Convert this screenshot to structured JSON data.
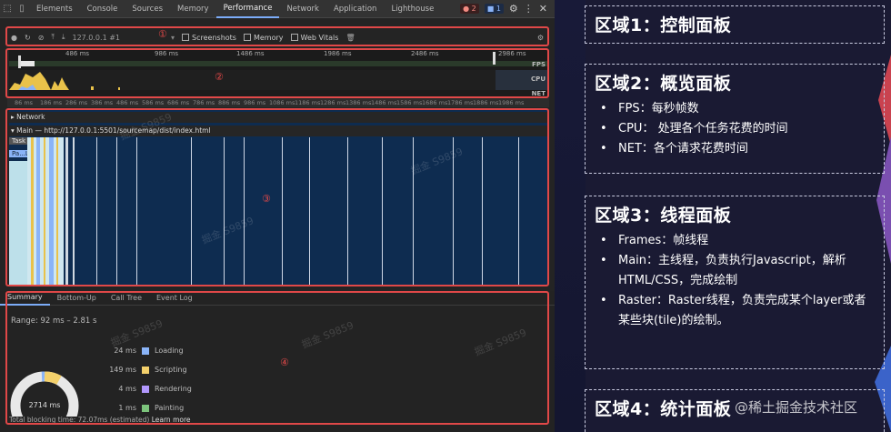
{
  "devtools": {
    "tabs": [
      "Elements",
      "Console",
      "Sources",
      "Memory",
      "Performance",
      "Network",
      "Application",
      "Lighthouse"
    ],
    "active_tab": "Performance",
    "error_count": "2",
    "message_count": "1",
    "controls": {
      "url": "127.0.0.1 #1",
      "screenshots_label": "Screenshots",
      "memory_label": "Memory",
      "webvitals_label": "Web Vitals"
    },
    "overview": {
      "ticks": [
        "486 ms",
        "986 ms",
        "1486 ms",
        "1986 ms",
        "2486 ms",
        "2986 ms"
      ],
      "labels": [
        "FPS",
        "CPU",
        "NET"
      ]
    },
    "scrubber_ticks": [
      "86 ms",
      "186 ms",
      "286 ms",
      "386 ms",
      "486 ms",
      "586 ms",
      "686 ms",
      "786 ms",
      "886 ms",
      "986 ms",
      "1086 ms",
      "1186 ms",
      "1286 ms",
      "1386 ms",
      "1486 ms",
      "1586 ms",
      "1686 ms",
      "1786 ms",
      "1886 ms",
      "1986 ms"
    ],
    "threads": {
      "network": "Network",
      "main": "Main — http://127.0.0.1:5501/sourcemap/dist/index.html",
      "task": "Task",
      "task2": "Pa...L"
    },
    "region_labels": [
      "①",
      "②",
      "③",
      "④"
    ],
    "summary": {
      "tabs": [
        "Summary",
        "Bottom-Up",
        "Call Tree",
        "Event Log"
      ],
      "range": "Range: 92 ms – 2.81 s",
      "total": "2714 ms",
      "items": [
        {
          "ms": "24 ms",
          "label": "Loading",
          "color": "#8ab4f8"
        },
        {
          "ms": "149 ms",
          "label": "Scripting",
          "color": "#f3d06b"
        },
        {
          "ms": "4 ms",
          "label": "Rendering",
          "color": "#b197fc"
        },
        {
          "ms": "1 ms",
          "label": "Painting",
          "color": "#7cc47c"
        }
      ],
      "footer_prefix": "Total blocking time: 72.07ms (estimated)",
      "footer_link": "Learn more"
    },
    "watermark": "掘金 S9859"
  },
  "panels": [
    {
      "title": "区域1：控制面板",
      "items": []
    },
    {
      "title": "区域2：概览面板",
      "items": [
        "FPS：每秒帧数",
        "CPU：  处理各个任务花费的时间",
        "NET：各个请求花费时间"
      ]
    },
    {
      "title": "区域3：线程面板",
      "items": [
        "Frames：帧线程",
        "Main：主线程，负责执行Javascript，解析HTML/CSS，完成绘制",
        "Raster：Raster线程，负责完成某个layer或者某些块(tile)的绘制。"
      ]
    },
    {
      "title": "区域4：统计面板",
      "items": []
    }
  ],
  "community": "@稀土掘金技术社区"
}
